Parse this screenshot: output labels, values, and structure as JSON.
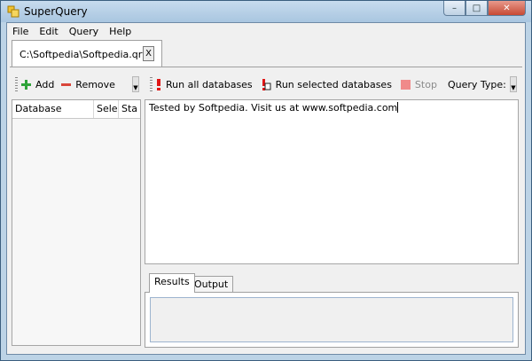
{
  "window": {
    "title": "SuperQuery",
    "app_icon": "superquery-app-icon",
    "controls": {
      "minimize": "–",
      "maximize": "□",
      "close": "✕"
    }
  },
  "menu": {
    "items": [
      {
        "id": "file",
        "label": "File"
      },
      {
        "id": "edit",
        "label": "Edit"
      },
      {
        "id": "query",
        "label": "Query"
      },
      {
        "id": "help",
        "label": "Help"
      }
    ]
  },
  "document": {
    "tab_label": "C:\\Softpedia\\Softpedia.qry",
    "close_label": "X"
  },
  "left_toolbar": {
    "add_label": "Add",
    "add_icon": "plus-icon",
    "remove_label": "Remove",
    "remove_icon": "minus-icon"
  },
  "database_grid": {
    "columns": [
      "Database",
      "Sele",
      "Sta"
    ],
    "rows": []
  },
  "right_toolbar": {
    "run_all_label": "Run all databases",
    "run_all_icon": "exclamation-icon",
    "run_selected_label": "Run selected databases",
    "run_selected_icon": "run-selected-icon",
    "stop_label": "Stop",
    "stop_icon": "stop-icon",
    "query_type_label": "Query Type:"
  },
  "editor": {
    "text": "Tested by Softpedia. Visit us at www.softpedia.com"
  },
  "results": {
    "tabs": [
      {
        "id": "results",
        "label": "Results",
        "active": true
      },
      {
        "id": "output",
        "label": "Output",
        "active": false
      }
    ]
  },
  "colors": {
    "add_green": "#2fa43a",
    "remove_red": "#d9453a",
    "run_red": "#e01515",
    "stop_pink": "#f08a8a"
  }
}
